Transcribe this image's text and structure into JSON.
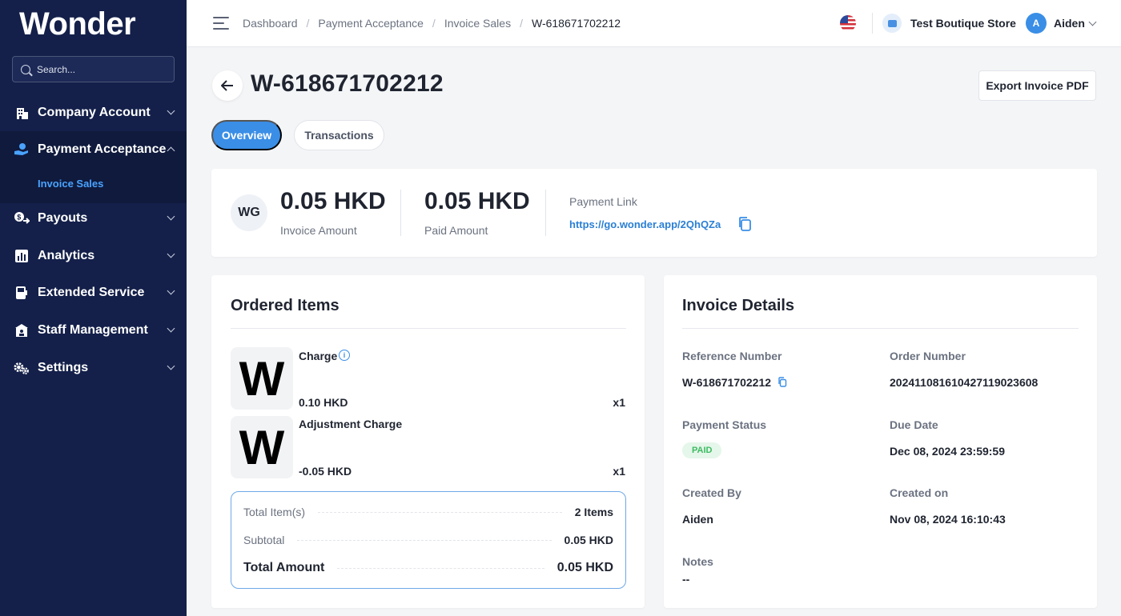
{
  "brand": {
    "logo": "Wonder"
  },
  "search": {
    "placeholder": "Search..."
  },
  "sidebar": {
    "items": [
      {
        "label": "Company Account",
        "icon": "building-icon"
      },
      {
        "label": "Payment Acceptance",
        "icon": "hand-coin-icon",
        "expanded": true
      },
      {
        "label": "Payouts",
        "icon": "payout-icon"
      },
      {
        "label": "Analytics",
        "icon": "bar-chart-icon"
      },
      {
        "label": "Extended Service",
        "icon": "pos-terminal-icon"
      },
      {
        "label": "Staff Management",
        "icon": "staff-icon"
      },
      {
        "label": "Settings",
        "icon": "gears-icon"
      }
    ],
    "subitem": "Invoice Sales"
  },
  "topbar": {
    "breadcrumbs": [
      "Dashboard",
      "Payment Acceptance",
      "Invoice Sales",
      "W-618671702212"
    ],
    "store": "Test Boutique Store",
    "avatar_initial": "A",
    "user": "Aiden"
  },
  "page": {
    "title": "W-618671702212",
    "export_label": "Export Invoice PDF",
    "tabs": [
      "Overview",
      "Transactions"
    ]
  },
  "summary": {
    "initials": "WG",
    "invoice_amount": "0.05 HKD",
    "invoice_amount_label": "Invoice Amount",
    "paid_amount": "0.05 HKD",
    "paid_amount_label": "Paid Amount",
    "payment_link_label": "Payment Link",
    "payment_link": "https://go.wonder.app/2QhQZa"
  },
  "ordered": {
    "title": "Ordered Items",
    "items": [
      {
        "thumb": "W",
        "name": "Charge",
        "price": "0.10 HKD",
        "qty": "x1"
      },
      {
        "thumb": "W",
        "name": "Adjustment Charge",
        "price": "-0.05 HKD",
        "qty": "x1"
      }
    ],
    "totals": [
      {
        "label": "Total Item(s)",
        "value": "2 Items"
      },
      {
        "label": "Subtotal",
        "value": "0.05 HKD"
      },
      {
        "label": "Total Amount",
        "value": "0.05 HKD"
      }
    ]
  },
  "details": {
    "title": "Invoice Details",
    "reference_label": "Reference Number",
    "reference": "W-618671702212",
    "order_label": "Order Number",
    "order": "20241108161042711902360­8",
    "status_label": "Payment Status",
    "status": "PAID",
    "due_label": "Due Date",
    "due": "Dec 08, 2024 23:59:59",
    "created_by_label": "Created By",
    "created_by": "Aiden",
    "created_on_label": "Created on",
    "created_on": "Nov 08, 2024 16:10:43",
    "notes_label": "Notes",
    "notes": "--"
  },
  "colors": {
    "sidebar": "#14204a",
    "accent": "#3a8ee6",
    "paid": "#3dbb63"
  }
}
